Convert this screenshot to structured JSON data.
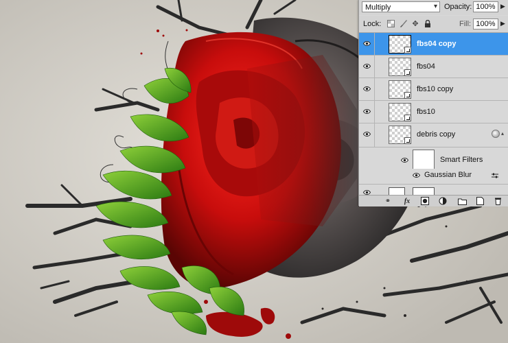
{
  "panel": {
    "blend_mode": "Multiply",
    "opacity_label": "Opacity:",
    "opacity_value": "100%",
    "lock_label": "Lock:",
    "fill_label": "Fill:",
    "fill_value": "100%",
    "layers": [
      {
        "name": "fbs04 copy",
        "selected": true
      },
      {
        "name": "fbs04",
        "selected": false
      },
      {
        "name": "fbs10 copy",
        "selected": false
      },
      {
        "name": "fbs10",
        "selected": false
      },
      {
        "name": "debris copy",
        "selected": false
      }
    ],
    "smart_filters_label": "Smart Filters",
    "filter_name": "Gaussian Blur",
    "icons": {
      "visibility": "eye-icon",
      "lock_transparent": "checker-icon",
      "lock_paint": "brush-icon",
      "lock_position": "move-icon",
      "lock_all": "padlock-icon",
      "fx": "fx-icon",
      "link": "link-icon",
      "mask": "mask-icon",
      "adjustment": "half-circle-icon",
      "group": "folder-icon",
      "new_layer": "new-layer-icon",
      "delete": "trash-icon"
    },
    "colors": {
      "selection": "#3d95ea",
      "panel_bg": "#d8d8d8"
    }
  }
}
